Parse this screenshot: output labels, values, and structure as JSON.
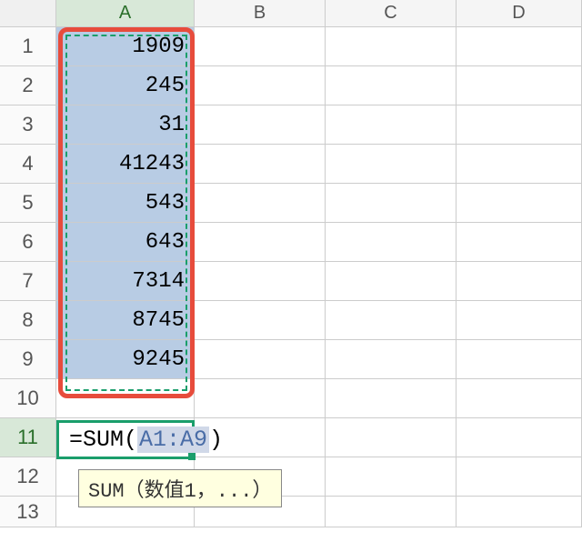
{
  "columns": [
    "A",
    "B",
    "C",
    "D"
  ],
  "active_column_index": 0,
  "active_row": 11,
  "rows": [
    {
      "num": 1,
      "a": "1909"
    },
    {
      "num": 2,
      "a": "245"
    },
    {
      "num": 3,
      "a": "31"
    },
    {
      "num": 4,
      "a": "41243"
    },
    {
      "num": 5,
      "a": "543"
    },
    {
      "num": 6,
      "a": "643"
    },
    {
      "num": 7,
      "a": "7314"
    },
    {
      "num": 8,
      "a": "8745"
    },
    {
      "num": 9,
      "a": "9245"
    },
    {
      "num": 10,
      "a": ""
    },
    {
      "num": 11,
      "a": ""
    },
    {
      "num": 12,
      "a": ""
    },
    {
      "num": 13,
      "a": ""
    }
  ],
  "formula": {
    "prefix": "=SUM(",
    "ref": "A1:A9",
    "suffix": ")"
  },
  "tooltip": "SUM（数值1，...）",
  "chart_data": {
    "type": "table",
    "selected_range": "A1:A9",
    "values": [
      1909,
      245,
      31,
      41243,
      543,
      643,
      7314,
      8745,
      9245
    ],
    "formula_cell": "A11",
    "formula": "=SUM(A1:A9)"
  }
}
